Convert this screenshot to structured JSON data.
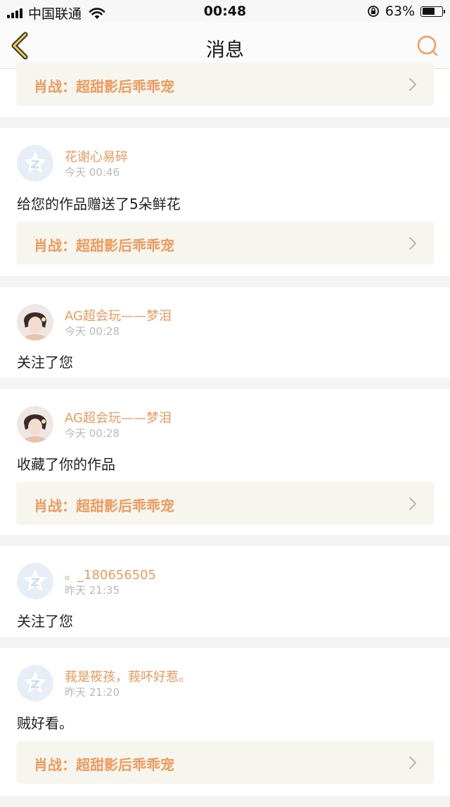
{
  "status_bar": {
    "carrier": "中国联通",
    "time": "00:48",
    "battery_percent": "63%",
    "battery_level": 0.63
  },
  "nav": {
    "title": "消息",
    "back_icon": "chevron-left-icon",
    "search_icon": "search-icon"
  },
  "colors": {
    "accent": "#ef9a5e",
    "link_bg": "#f6f6ee",
    "divider": "#f4f4f4"
  },
  "top_link": {
    "title": "肖战：超甜影后乖乖宠"
  },
  "messages": [
    {
      "user": "花谢心易碎",
      "time": "今天 00:46",
      "action": "给您的作品赠送了5朵鲜花",
      "avatar": "default-avatar-icon",
      "link": "肖战：超甜影后乖乖宠"
    },
    {
      "user": "AG超会玩——梦泪",
      "time": "今天 00:28",
      "action": "关注了您",
      "avatar": "photo-avatar"
    },
    {
      "user": "AG超会玩——梦泪",
      "time": "今天 00:28",
      "action": "收藏了你的作品",
      "avatar": "photo-avatar",
      "link": "肖战：超甜影后乖乖宠"
    },
    {
      "user": "。_180656505",
      "time": "昨天 21:35",
      "action": "关注了您",
      "avatar": "default-avatar-icon"
    },
    {
      "user": "莪是筱孩，莪吥好惹。",
      "time": "昨天 21:20",
      "action": "贼好看。",
      "avatar": "default-avatar-icon",
      "link": "肖战：超甜影后乖乖宠"
    }
  ]
}
